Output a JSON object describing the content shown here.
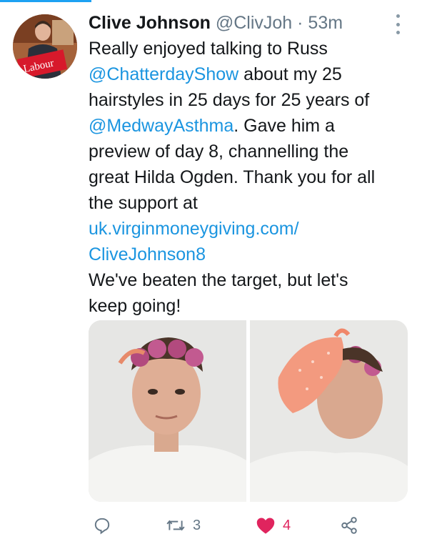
{
  "tweet": {
    "display_name": "Clive Johnson",
    "handle": "@ClivJoh",
    "separator": "·",
    "timestamp": "53m",
    "avatar_sign_text": "Labour",
    "text_lines": [
      [
        {
          "text": "Really enjoyed talking to Russ",
          "link": false
        }
      ],
      [
        {
          "text": "@ChatterdayShow",
          "link": true
        },
        {
          "text": " about my 25",
          "link": false
        }
      ],
      [
        {
          "text": "hairstyles in 25 days for 25 years of",
          "link": false
        }
      ],
      [
        {
          "text": "@MedwayAsthma",
          "link": true
        },
        {
          "text": ". Gave him a",
          "link": false
        }
      ],
      [
        {
          "text": "preview of day 8, channelling the",
          "link": false
        }
      ],
      [
        {
          "text": "great Hilda Ogden. Thank you for all",
          "link": false
        }
      ],
      [
        {
          "text": "the support at",
          "link": false
        }
      ],
      [
        {
          "text": "uk.virginmoneygiving.com/",
          "link": true
        }
      ],
      [
        {
          "text": "CliveJohnson8",
          "link": true
        }
      ],
      [
        {
          "text": "We've beaten the target, but let's",
          "link": false
        }
      ],
      [
        {
          "text": "keep going!",
          "link": false
        }
      ]
    ]
  },
  "actions": {
    "reply": {
      "icon": "reply-icon",
      "count": ""
    },
    "retweet": {
      "icon": "retweet-icon",
      "count": "3"
    },
    "like": {
      "icon": "heart-icon",
      "count": "4",
      "liked": true
    },
    "share": {
      "icon": "share-icon"
    }
  },
  "colors": {
    "link": "#1b95e0",
    "like": "#e0245e",
    "muted": "#657786",
    "accent": "#1da1f2"
  }
}
